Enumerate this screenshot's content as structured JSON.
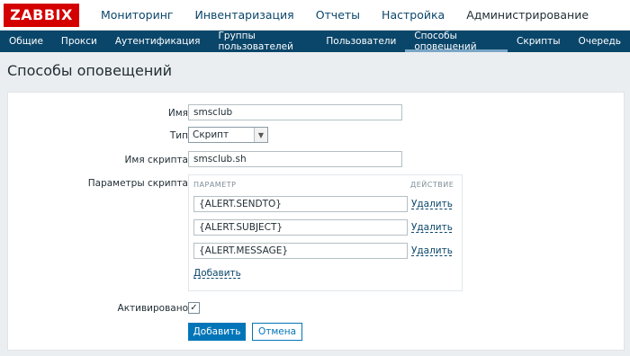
{
  "brand": "ZABBIX",
  "topnav": [
    "Мониторинг",
    "Инвентаризация",
    "Отчеты",
    "Настройка",
    "Администрирование"
  ],
  "subnav": [
    "Общие",
    "Прокси",
    "Аутентификация",
    "Группы пользователей",
    "Пользователи",
    "Способы оповещений",
    "Скрипты",
    "Очередь"
  ],
  "page_title": "Способы оповещений",
  "form": {
    "name_label": "Имя",
    "name_value": "smsclub",
    "type_label": "Тип",
    "type_value": "Скрипт",
    "script_label": "Имя скрипта",
    "script_value": "smsclub.sh",
    "params_label": "Параметры скрипта",
    "params_header_param": "ПАРАМЕТР",
    "params_header_action": "ДЕЙСТВИЕ",
    "params": [
      {
        "value": "{ALERT.SENDTO}",
        "remove": "Удалить"
      },
      {
        "value": "{ALERT.SUBJECT}",
        "remove": "Удалить"
      },
      {
        "value": "{ALERT.MESSAGE}",
        "remove": "Удалить"
      }
    ],
    "add_link": "Добавить",
    "enabled_label": "Активировано",
    "enabled_checked": true,
    "submit_label": "Добавить",
    "cancel_label": "Отмена"
  },
  "colors": {
    "brand_red": "#d40000",
    "nav_blue": "#0a466a",
    "button_blue": "#0275b8"
  },
  "icons": [
    "checkbox-check-icon",
    "dropdown-arrow-icon"
  ]
}
